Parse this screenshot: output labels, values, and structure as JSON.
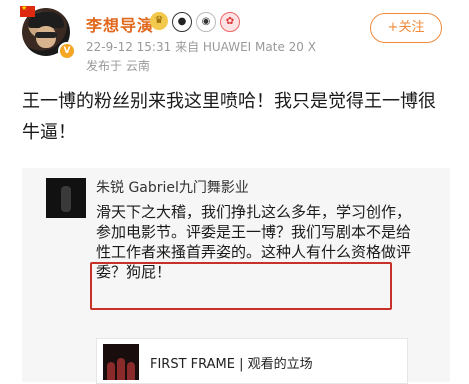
{
  "post": {
    "username": "李想导演",
    "badges": [
      "crown-badge-icon",
      "panda-badge-icon",
      "panda2-badge-icon",
      "lantern-badge-icon"
    ],
    "timestamp": "22-9-12 15:31",
    "device": "来自 HUAWEI Mate 20 X",
    "location": "发布于 云南",
    "follow_label": "+关注",
    "text": "王一博的粉丝别来我这里喷哈！我只是觉得王一博很牛逼！"
  },
  "quoted": {
    "name": "朱锐 Gabriel九门舞影业",
    "text_before": "滑天下之大稽，我们挣扎这么多年，学习创作，参加电影节。",
    "text_highlight": "评委是王一博？我们写剧本不是给性工作者来搔首弄姿",
    "text_after": "的。这种人有什么资格做评委？狗屁！"
  },
  "link_card": {
    "title": "FIRST FRAME | 观看的立场"
  },
  "colors": {
    "username": "#e0691e",
    "follow": "#f08a3a",
    "highlight_border": "#c8312a",
    "quote_bg": "#f6f6f6"
  }
}
